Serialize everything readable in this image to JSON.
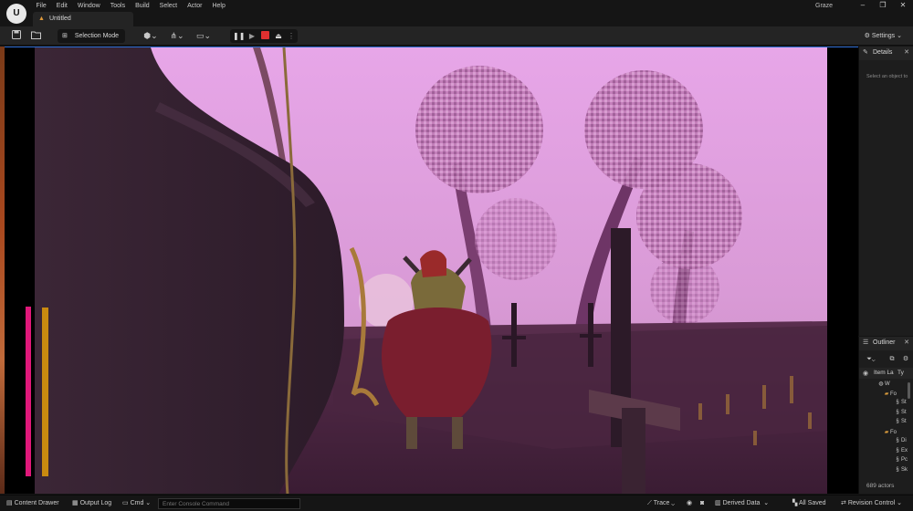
{
  "app": {
    "logo_text": "U",
    "project_name": "Graze",
    "tab_label": "Untitled"
  },
  "menu": [
    "File",
    "Edit",
    "Window",
    "Tools",
    "Build",
    "Select",
    "Actor",
    "Help"
  ],
  "toolbar": {
    "mode_label": "Selection Mode",
    "settings_label": "Settings"
  },
  "details": {
    "tab_label": "Details",
    "hint": "Select an object to"
  },
  "outliner": {
    "tab_label": "Outliner",
    "col_label": "Item La",
    "col_type": "Ty",
    "rows": [
      {
        "icon": "world-icon",
        "text": "W"
      },
      {
        "icon": "folder-icon",
        "text": "Fo"
      },
      {
        "icon": "actor-icon",
        "text": "St"
      },
      {
        "icon": "actor-icon",
        "text": "St"
      },
      {
        "icon": "actor-icon",
        "text": "St"
      },
      {
        "icon": "folder-icon",
        "text": "Fo"
      },
      {
        "icon": "actor-icon",
        "text": "Di"
      },
      {
        "icon": "actor-icon",
        "text": "Ex"
      },
      {
        "icon": "actor-icon",
        "text": "Pc"
      },
      {
        "icon": "actor-icon",
        "text": "Sk"
      }
    ],
    "actor_count": "689 actors"
  },
  "statusbar": {
    "content_drawer": "Content Drawer",
    "output_log": "Output Log",
    "cmd_label": "Cmd",
    "cmd_placeholder": "Enter Console Command",
    "trace": "Trace",
    "derived_data": "Derived Data",
    "all_saved": "All Saved",
    "revision_control": "Revision Control"
  },
  "colors": {
    "accent_record": "#e03030",
    "play_green": "#4caf50",
    "folder": "#d99b3c",
    "health_bar": "#e0187a",
    "stamina_bar": "#c98a10"
  }
}
